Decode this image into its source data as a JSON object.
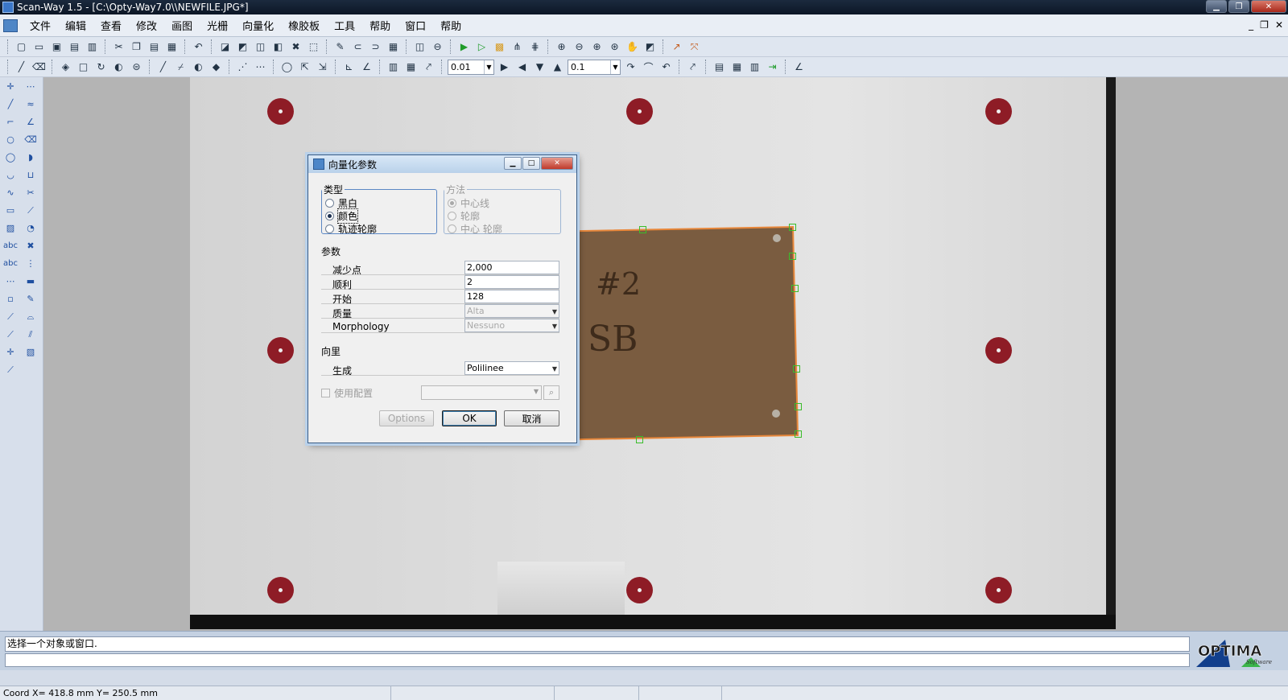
{
  "window": {
    "title": "Scan-Way 1.5 - [C:\\Opty-Way7.0\\\\NEWFILE.JPG*]",
    "min": "▁",
    "max": "❐",
    "close": "✕"
  },
  "menu": {
    "items": [
      "文件",
      "编辑",
      "查看",
      "修改",
      "画图",
      "光栅",
      "向量化",
      "橡胶板",
      "工具",
      "帮助",
      "窗口",
      "帮助"
    ],
    "mdi_min": "_",
    "mdi_restore": "❐",
    "mdi_close": "✕"
  },
  "toolbar2": {
    "combo1": "0.01",
    "combo2": "0.1"
  },
  "left_tools": {
    "abc1": "abc",
    "abc2": "abc"
  },
  "dialog": {
    "title": "向量化参数",
    "type_group": {
      "legend": "类型",
      "options": [
        "黑白",
        "颜色",
        "轨迹轮廓"
      ],
      "selected": "颜色"
    },
    "method_group": {
      "legend": "方法",
      "options": [
        "中心线",
        "轮廓",
        "中心 轮廓"
      ],
      "selected": "中心线"
    },
    "params_label": "参数",
    "params": [
      {
        "label": "减少点",
        "value": "2,000"
      },
      {
        "label": "顺利",
        "value": "2"
      },
      {
        "label": "开始",
        "value": "128"
      },
      {
        "label": "质量",
        "value": "Alta"
      },
      {
        "label": "Morphology",
        "value": "Nessuno"
      }
    ],
    "vector_label": "向里",
    "generate_label": "生成",
    "generate_value": "Polilinee",
    "use_config_label": "使用配置",
    "options_btn": "Options",
    "ok_btn": "OK",
    "cancel_btn": "取消"
  },
  "board": {
    "text1": "#2",
    "text2": "SB"
  },
  "message": {
    "line1": "选择一个对象或窗口.",
    "line2": ""
  },
  "logo": {
    "name": "OPTIMA",
    "tag": "Software"
  },
  "status": {
    "coord": "Coord  X= 418.8 mm  Y= 250.5 mm"
  },
  "colors": {
    "target": "#8e1c26",
    "board": "#7a5c40",
    "outline": "#e8873a",
    "handle": "#3bbd2b"
  }
}
